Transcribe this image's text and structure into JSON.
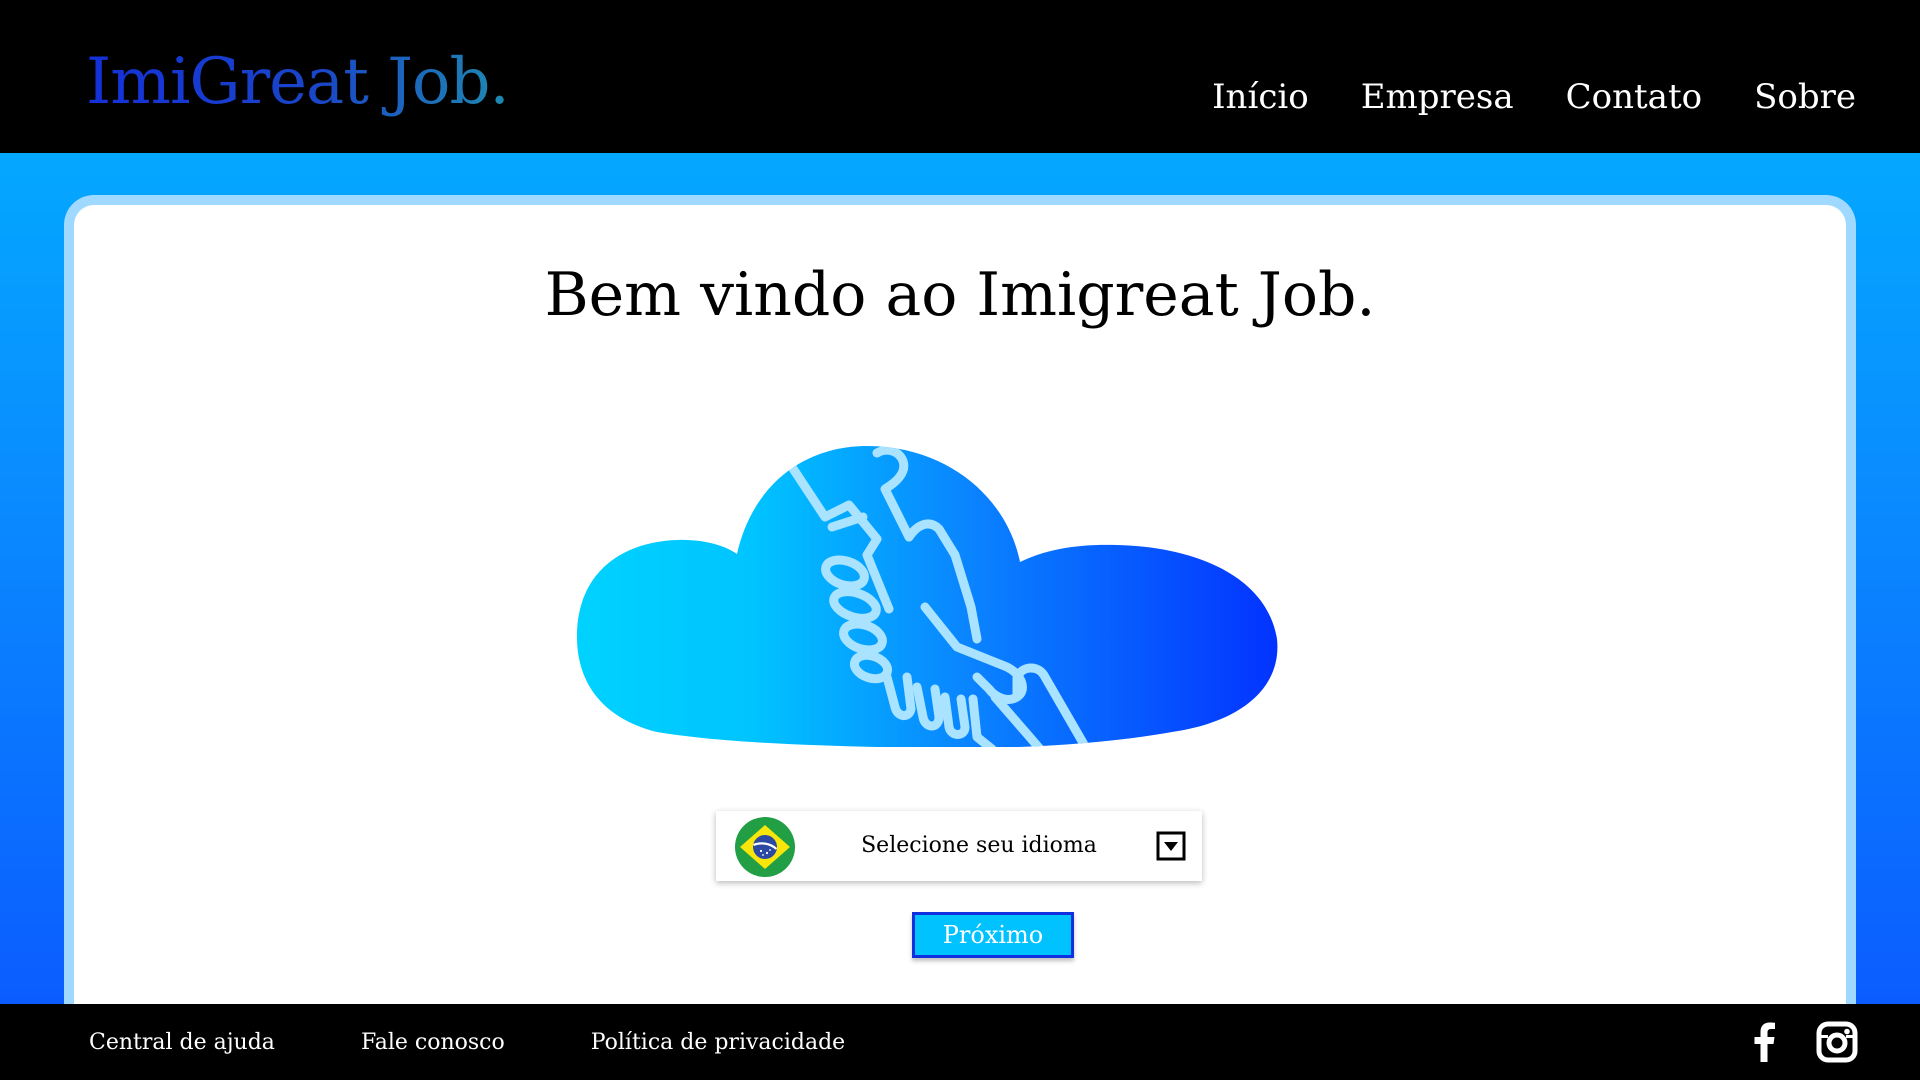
{
  "header": {
    "logo": "ImiGreat Job.",
    "nav": [
      {
        "label": "Início"
      },
      {
        "label": "Empresa"
      },
      {
        "label": "Contato"
      },
      {
        "label": "Sobre"
      }
    ]
  },
  "main": {
    "welcome": "Bem vindo ao Imigreat Job.",
    "illustration": "cloud-handshake-icon",
    "language_select": {
      "flag": "brazil-flag-icon",
      "label": "Selecione seu idioma",
      "icon": "dropdown-arrow-icon"
    },
    "next_button": "Próximo"
  },
  "footer": {
    "links": [
      {
        "label": "Central de ajuda"
      },
      {
        "label": "Fale conosco"
      },
      {
        "label": "Política de privacidade"
      }
    ],
    "social": [
      "facebook-icon",
      "instagram-icon"
    ]
  },
  "colors": {
    "header_bg": "#000000",
    "page_gradient_top": "#00b4ff",
    "page_gradient_bottom": "#0b55ff",
    "button_bg": "#00c2ff",
    "button_border": "#1030e0"
  }
}
